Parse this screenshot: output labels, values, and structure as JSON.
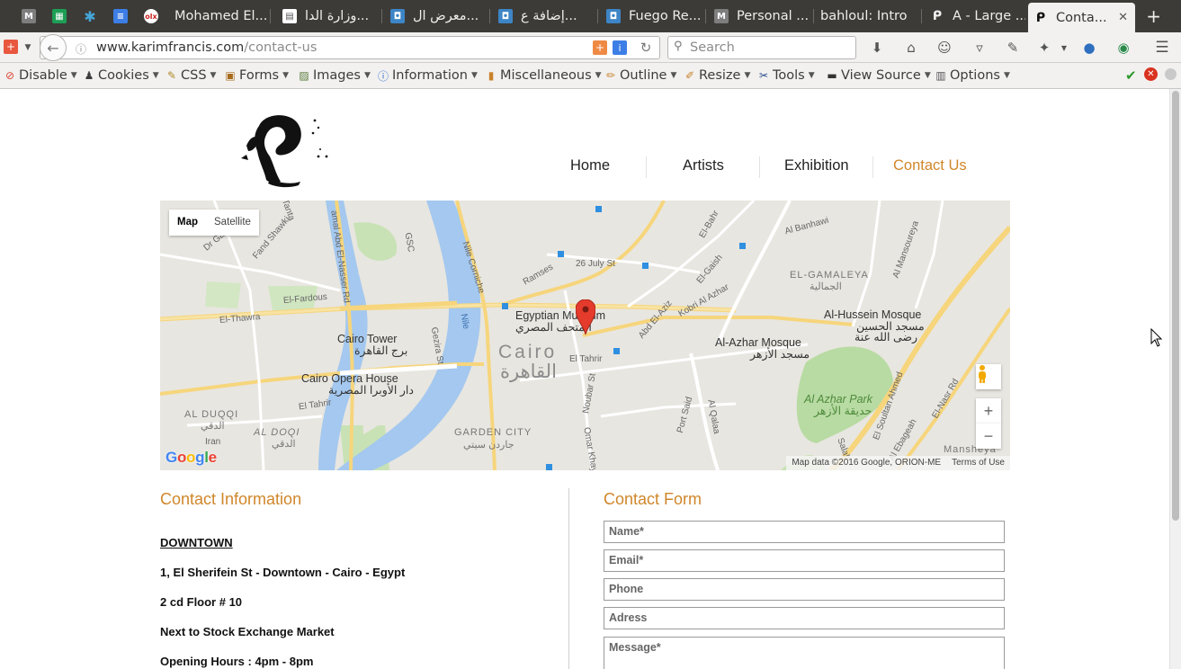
{
  "browser": {
    "tabs": [
      {
        "label": "",
        "icon": "gmail-icon"
      },
      {
        "label": "",
        "icon": "sheets-icon"
      },
      {
        "label": "",
        "icon": "asterisk-icon"
      },
      {
        "label": "",
        "icon": "docs-icon"
      },
      {
        "label": "",
        "icon": "olx-icon"
      },
      {
        "label": "Mohamed El...",
        "icon": "mail-icon"
      },
      {
        "label": "وزارة الدا...",
        "icon": "document-icon"
      },
      {
        "label": "معرض ال...",
        "icon": "app-icon"
      },
      {
        "label": "إضافة ع...",
        "icon": "app-icon"
      },
      {
        "label": "Fuego Re...",
        "icon": "app-icon"
      },
      {
        "label": "Personal ...",
        "icon": "mail-icon"
      },
      {
        "label": "bahloul: Intro",
        "icon": ""
      },
      {
        "label": "A - Large ...",
        "icon": "page-icon"
      },
      {
        "label": "Conta...",
        "icon": "site-icon"
      }
    ],
    "url_host": "www.karimfrancis.com",
    "url_path": "/contact-us",
    "search_placeholder": "Search"
  },
  "devbar": {
    "items": [
      "Disable",
      "Cookies",
      "CSS",
      "Forms",
      "Images",
      "Information",
      "Miscellaneous",
      "Outline",
      "Resize",
      "Tools",
      "View Source",
      "Options"
    ]
  },
  "site": {
    "nav": [
      "Home",
      "Artists",
      "Exhibition",
      "Contact Us"
    ],
    "active_nav": "Contact Us",
    "accent": "#d0862a"
  },
  "map": {
    "mode_buttons": [
      "Map",
      "Satellite"
    ],
    "active_mode": "Map",
    "zoom_in": "+",
    "zoom_out": "−",
    "google": "Google",
    "credit": "Map data ©2016 Google, ORION-ME",
    "terms": "Terms of Use",
    "labels": {
      "cairo": "Cairo",
      "cairo_ar": "القاهرة",
      "egyptian_museum": "Egyptian Museum",
      "egyptian_museum_ar": "المتحف المصري",
      "cairo_tower": "Cairo Tower",
      "cairo_tower_ar": "برج القاهرة",
      "opera_house": "Cairo Opera House",
      "opera_house_ar": "دار الأوبرا المصرية",
      "al_duqqi": "AL DUQQI",
      "al_duqqi_ar": "الدقي",
      "al_doqi": "AL DOQI",
      "al_doqi_ar": "الدقي",
      "garden_city": "GARDEN CITY",
      "garden_city_ar": "جاردن سيتي",
      "el_gamaleya": "EL-GAMALEYA",
      "el_gamaleya_ar": "الجمالية",
      "hussein_mosque": "Al-Hussein Mosque",
      "hussein_mosque_ar1": "مسجد الحسين",
      "hussein_mosque_ar2": "رضى الله عنة",
      "azhar_mosque": "Al-Azhar Mosque",
      "azhar_mosque_ar": "مسجد الأزهر",
      "azhar_park": "Al Azhar Park",
      "azhar_park_ar": "حديقة الأزهر",
      "july_26": "26 July St",
      "ramses": "Ramses",
      "el_tahrir": "El Tahrir",
      "el_tahrir_w": "El Tahrir",
      "el_fardous": "El-Fardous",
      "el_thawra": "El-Thawra",
      "gezira": "Gezira St",
      "nile": "Nile",
      "nile_corniche": "Nile Corniche",
      "nasser_rd": "amal Abd El-Nasser Rd",
      "abd_el_aziz": "Abd El-Aziz",
      "kobri_azhar": "Kobri Al Azhar",
      "el_gaish": "El-Gaish",
      "port_said": "Port Said",
      "al_qalaa": "Al Qalaa",
      "salah": "Salah",
      "nasr_rd": "El-Nasr Rd",
      "ebageah": "Al Ebageah",
      "soultan": "El Soultan Ahmed",
      "mansheya": "Mansheya",
      "nubar": "Noubar St",
      "omar_khayyam": "Omar Khayyam",
      "iran": "Iran",
      "el_banhawi": "Al Banhawi",
      "tanta": "Tanta",
      "gamal": "Dr Gamal",
      "fand": "Fand Shawki",
      "gsc": "GSC",
      "el_bahr": "El-Bahr",
      "mansoureya": "Al Mansoureya"
    }
  },
  "contact_info": {
    "title": "Contact Information",
    "location": "DOWNTOWN",
    "address": "1, El Sherifein St - Downtown - Cairo - Egypt",
    "floor": "2 cd Floor # 10",
    "landmark": "Next to Stock Exchange Market",
    "hours": "Opening Hours : 4pm - 8pm"
  },
  "contact_form": {
    "title": "Contact Form",
    "name_placeholder": "Name*",
    "email_placeholder": "Email*",
    "phone_placeholder": "Phone",
    "address_placeholder": "Adress",
    "message_placeholder": "Message*"
  }
}
